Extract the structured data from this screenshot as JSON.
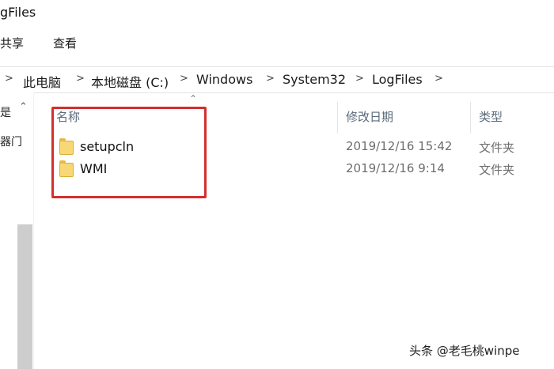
{
  "window": {
    "title": "gFiles"
  },
  "ribbon": {
    "tabs": [
      "共享",
      "查看"
    ]
  },
  "address_bar": {
    "crumbs": [
      "此电脑",
      "本地磁盘 (C:)",
      "Windows",
      "System32",
      "LogFiles"
    ]
  },
  "nav_pane": {
    "items": [
      "是",
      "器门"
    ]
  },
  "columns": {
    "name": "名称",
    "modified": "修改日期",
    "type": "类型"
  },
  "files": [
    {
      "name": "setupcln",
      "modified": "2019/12/16 15:42",
      "type": "文件夹"
    },
    {
      "name": "WMI",
      "modified": "2019/12/16 9:14",
      "type": "文件夹"
    }
  ],
  "highlight_color": "#d32f2f",
  "watermark": "头条 @老毛桃winpe"
}
